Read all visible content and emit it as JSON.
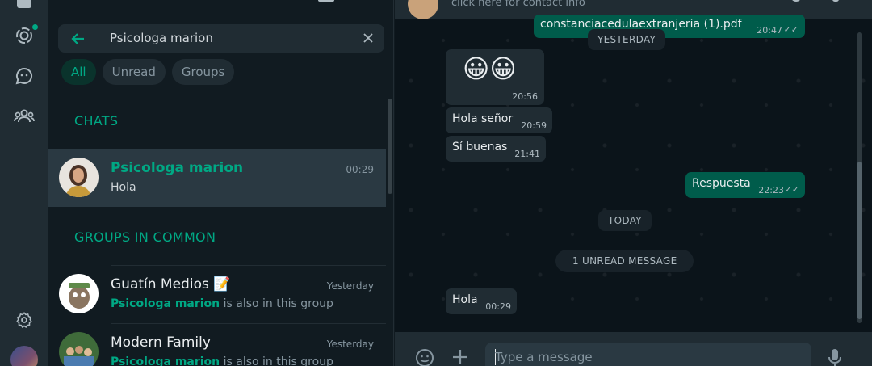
{
  "colors": {
    "accent": "#00a884",
    "panel": "#202c33",
    "bg": "#111b21",
    "outgoing": "#005c4b"
  },
  "rail": {
    "icons": [
      "chats-icon",
      "status-icon",
      "channels-icon",
      "communities-icon",
      "settings-icon"
    ]
  },
  "search": {
    "value": "Psicologa marion"
  },
  "filters": [
    "All",
    "Unread",
    "Groups"
  ],
  "sections": {
    "chats": "CHATS",
    "groups": "GROUPS IN COMMON"
  },
  "chat_results": [
    {
      "name": "Psicologa marion",
      "time": "00:29",
      "preview": "Hola"
    }
  ],
  "group_results": [
    {
      "name": "Guatín Medios 📝",
      "time": "Yesterday",
      "member": "Psicologa marion",
      "rest": " is also in this group"
    },
    {
      "name": "Modern Family",
      "time": "Yesterday",
      "member": "Psicologa marion",
      "rest": " is also in this group"
    }
  ],
  "conversation": {
    "header_hint": "click here for contact info",
    "file_message": {
      "text": "constanciacedulaextranjeria (1).pdf",
      "time": "20:47"
    },
    "separator_yesterday": "YESTERDAY",
    "messages": [
      {
        "text": "😀😀",
        "time": "20:56"
      },
      {
        "text": "Hola señor",
        "time": "20:59"
      },
      {
        "text": "Sí buenas",
        "time": "21:41"
      },
      {
        "text": "Respuesta",
        "time": "22:23"
      }
    ],
    "separator_today": "TODAY",
    "unread": "1 UNREAD MESSAGE",
    "last_message": {
      "text": "Hola",
      "time": "00:29"
    }
  },
  "composer": {
    "placeholder": "Type a message"
  }
}
